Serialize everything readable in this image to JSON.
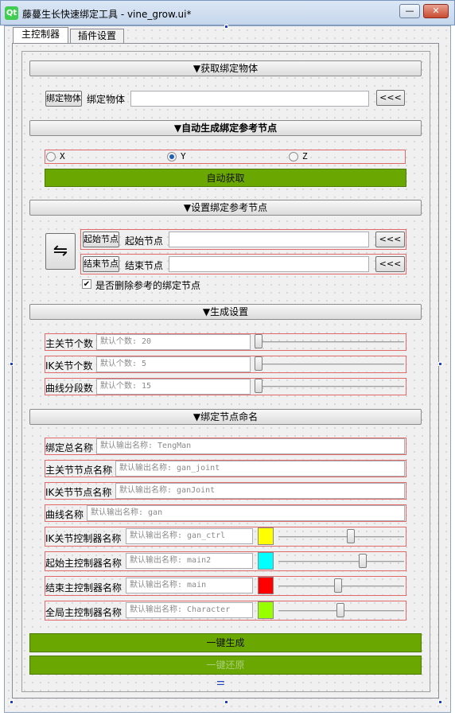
{
  "window": {
    "title": "藤蔓生长快速绑定工具 - vine_grow.ui*",
    "logo": "Qt",
    "minimize_glyph": "—",
    "maximize_glyph": "□",
    "close_glyph": "✕"
  },
  "tabs": [
    {
      "label": "主控制器",
      "active": true
    },
    {
      "label": "插件设置",
      "active": false
    }
  ],
  "get_object": {
    "header": "▼获取绑定物体",
    "button_label": "绑定物体",
    "field_label": "绑定物体",
    "field_value": "",
    "pick_label": "<<<"
  },
  "auto_ref": {
    "header": "▼自动生成绑定参考节点",
    "axes": [
      {
        "label": "X",
        "checked": false
      },
      {
        "label": "Y",
        "checked": true
      },
      {
        "label": "Z",
        "checked": false
      }
    ],
    "auto_button": "自动获取"
  },
  "set_ref": {
    "header": "▼设置绑定参考节点",
    "swap_glyph": "⇋",
    "start_button": "起始节点",
    "start_label": "起始节点",
    "start_value": "",
    "end_button": "结束节点",
    "end_label": "结束节点",
    "end_value": "",
    "pick_label": "<<<",
    "delete_checkbox_label": "是否删除参考的绑定节点",
    "delete_checked": true
  },
  "gen_settings": {
    "header": "▼生成设置",
    "rows": [
      {
        "label": "主关节个数",
        "placeholder": "默认个数: 20"
      },
      {
        "label": "IK关节个数",
        "placeholder": "默认个数: 5"
      },
      {
        "label": "曲线分段数",
        "placeholder": "默认个数: 15"
      }
    ]
  },
  "naming": {
    "header": "▼绑定节点命名",
    "rows": [
      {
        "label": "绑定总名称",
        "placeholder": "默认输出名称: TengMan"
      },
      {
        "label": "主关节节点名称",
        "placeholder": "默认输出名称: gan_joint"
      },
      {
        "label": "IK关节节点名称",
        "placeholder": "默认输出名称: ganJoint"
      },
      {
        "label": "曲线名称",
        "placeholder": "默认输出名称: gan"
      }
    ],
    "ctrl_rows": [
      {
        "label": "IK关节控制器名称",
        "placeholder": "默认输出名称: gan_ctrl",
        "color": "#ffff00",
        "slider": 0.58
      },
      {
        "label": "起始主控制器名称",
        "placeholder": "默认输出名称: main2",
        "color": "#00ffff",
        "slider": 0.68
      },
      {
        "label": "结束主控制器名称",
        "placeholder": "默认输出名称: main",
        "color": "#ff0000",
        "slider": 0.47
      },
      {
        "label": "全局主控制器名称",
        "placeholder": "默认输出名称: Character",
        "color": "#99ff00",
        "slider": 0.49
      }
    ]
  },
  "actions": {
    "generate": "一键生成",
    "restore": "一键还原",
    "handle_glyph": "⚌"
  },
  "colors": {
    "accent_green": "#6aa700",
    "error_outline": "#e06a6a"
  }
}
